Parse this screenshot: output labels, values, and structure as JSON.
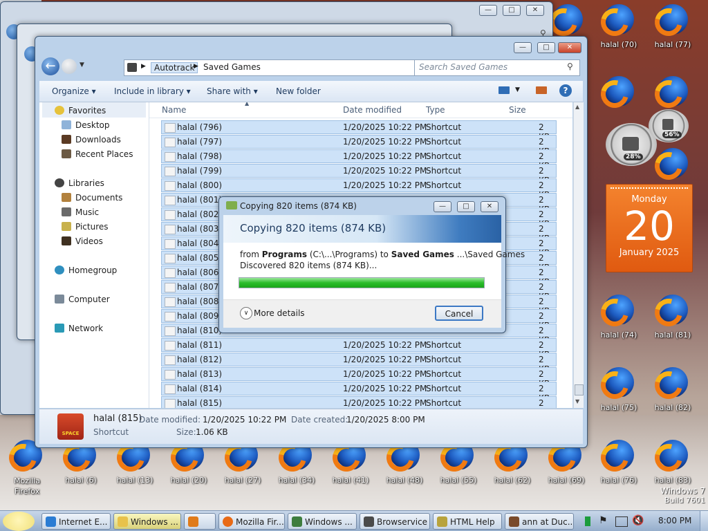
{
  "desktop": {
    "icons_right": [
      {
        "label": "halal (70)"
      },
      {
        "label": "halal (77)"
      },
      {
        "label": "halal (74)"
      },
      {
        "label": "halal (81)"
      },
      {
        "label": "halal (75)"
      },
      {
        "label": "halal (82)"
      },
      {
        "label": "halal (76)"
      },
      {
        "label": "halal (83)"
      }
    ],
    "icons_bottom": [
      {
        "label": "Mozilla Firefox"
      },
      {
        "label": "halal (6)"
      },
      {
        "label": "halal (13)"
      },
      {
        "label": "halal (20)"
      },
      {
        "label": "halal (27)"
      },
      {
        "label": "halal (34)"
      },
      {
        "label": "halal (41)"
      },
      {
        "label": "halal (48)"
      },
      {
        "label": "halal (55)"
      },
      {
        "label": "halal (62)"
      },
      {
        "label": "halal (69)"
      }
    ],
    "watermark": {
      "line1": "Windows 7",
      "line2": "Build 7601"
    }
  },
  "gadgets": {
    "cpu_percent": "28%",
    "mem_percent": "56%",
    "calendar": {
      "weekday": "Monday",
      "day": "20",
      "month_year": "January 2025"
    }
  },
  "explorer": {
    "breadcrumb": [
      "Autotrack",
      "Saved Games"
    ],
    "search_placeholder": "Search Saved Games",
    "commands": {
      "organize": "Organize",
      "include": "Include in library",
      "share": "Share with",
      "new_folder": "New folder"
    },
    "nav": {
      "favorites": "Favorites",
      "desktop": "Desktop",
      "downloads": "Downloads",
      "recent": "Recent Places",
      "libraries": "Libraries",
      "documents": "Documents",
      "music": "Music",
      "pictures": "Pictures",
      "videos": "Videos",
      "homegroup": "Homegroup",
      "computer": "Computer",
      "network": "Network"
    },
    "columns": {
      "name": "Name",
      "date": "Date modified",
      "type": "Type",
      "size": "Size"
    },
    "files": [
      {
        "name": "halal (796)",
        "date": "1/20/2025 10:22 PM",
        "type": "Shortcut",
        "size": "2 KB"
      },
      {
        "name": "halal (797)",
        "date": "1/20/2025 10:22 PM",
        "type": "Shortcut",
        "size": "2 KB"
      },
      {
        "name": "halal (798)",
        "date": "1/20/2025 10:22 PM",
        "type": "Shortcut",
        "size": "2 KB"
      },
      {
        "name": "halal (799)",
        "date": "1/20/2025 10:22 PM",
        "type": "Shortcut",
        "size": "2 KB"
      },
      {
        "name": "halal (800)",
        "date": "1/20/2025 10:22 PM",
        "type": "Shortcut",
        "size": "2 KB"
      },
      {
        "name": "halal (801)",
        "date": "",
        "type": "",
        "size": "2 KB"
      },
      {
        "name": "halal (802)",
        "date": "",
        "type": "",
        "size": "2 KB"
      },
      {
        "name": "halal (803)",
        "date": "",
        "type": "",
        "size": "2 KB"
      },
      {
        "name": "halal (804)",
        "date": "",
        "type": "",
        "size": "2 KB"
      },
      {
        "name": "halal (805)",
        "date": "",
        "type": "",
        "size": "2 KB"
      },
      {
        "name": "halal (806)",
        "date": "",
        "type": "",
        "size": "2 KB"
      },
      {
        "name": "halal (807)",
        "date": "",
        "type": "",
        "size": "2 KB"
      },
      {
        "name": "halal (808)",
        "date": "",
        "type": "",
        "size": "2 KB"
      },
      {
        "name": "halal (809)",
        "date": "",
        "type": "",
        "size": "2 KB"
      },
      {
        "name": "halal (810)",
        "date": "",
        "type": "",
        "size": "2 KB"
      },
      {
        "name": "halal (811)",
        "date": "1/20/2025 10:22 PM",
        "type": "Shortcut",
        "size": "2 KB"
      },
      {
        "name": "halal (812)",
        "date": "1/20/2025 10:22 PM",
        "type": "Shortcut",
        "size": "2 KB"
      },
      {
        "name": "halal (813)",
        "date": "1/20/2025 10:22 PM",
        "type": "Shortcut",
        "size": "2 KB"
      },
      {
        "name": "halal (814)",
        "date": "1/20/2025 10:22 PM",
        "type": "Shortcut",
        "size": "2 KB"
      },
      {
        "name": "halal (815)",
        "date": "1/20/2025 10:22 PM",
        "type": "Shortcut",
        "size": "2 KB"
      }
    ],
    "details": {
      "name": "halal (815)",
      "date_modified_label": "Date modified:",
      "date_modified": "1/20/2025 10:22 PM",
      "date_created_label": "Date created:",
      "date_created": "1/20/2025 8:00 PM",
      "type": "Shortcut",
      "size_label": "Size:",
      "size": "1.06 KB",
      "thumb_text": "SPACE"
    }
  },
  "copy_dialog": {
    "title": "Copying 820 items (874 KB)",
    "heading": "Copying 820 items (874 KB)",
    "from_prefix": "from",
    "from_name": "Programs",
    "from_path": "(C:\\...\\Programs)",
    "to_prefix": "to",
    "to_name": "Saved Games",
    "to_path": "...\\Saved Games",
    "discovered": "Discovered 820 items (874 KB)...",
    "progress": 1.0,
    "more_details": "More details",
    "cancel": "Cancel"
  },
  "taskbar": {
    "items": [
      {
        "label": "Internet E..."
      },
      {
        "label": "Windows ..."
      },
      {
        "label": ""
      },
      {
        "label": "Mozilla Fir..."
      },
      {
        "label": "Windows ..."
      },
      {
        "label": "Browservice"
      },
      {
        "label": "HTML Help"
      },
      {
        "label": "ann at Duc..."
      }
    ],
    "clock": "8:00 PM"
  },
  "colors": {
    "accent": "#2a62a5",
    "selection": "#cde2f8",
    "progress": "#2bbd2b",
    "calendar": "#e8661c"
  }
}
